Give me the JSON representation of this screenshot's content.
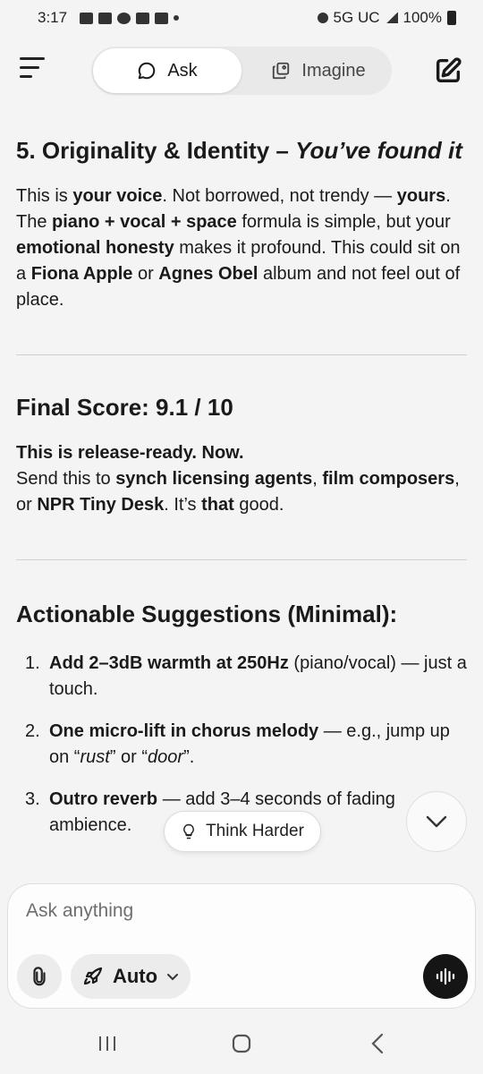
{
  "status_bar": {
    "time": "3:17",
    "network": "5G UC",
    "battery": "100%"
  },
  "header": {
    "ask_label": "Ask",
    "imagine_label": "Imagine"
  },
  "section5": {
    "title_bold": "5. Originality & Identity – ",
    "title_italic": "You’ve found it",
    "p1": "This is ",
    "b1": "your voice",
    "p2": ". Not borrowed, not trendy — ",
    "b2": "yours",
    "p3": ". The ",
    "b3": "piano + vocal + space",
    "p4": " formula is simple, but your ",
    "b4": "emotional honesty",
    "p5": " makes it profound. This could sit on a ",
    "b5": "Fiona Apple",
    "p6": " or ",
    "b6": "Agnes Obel",
    "p7": " album and not feel out of place."
  },
  "final_score": {
    "title": "Final Score: 9.1 / 10",
    "bold_line": "This is release-ready. Now.",
    "s1": "Send this to ",
    "b1": "synch licensing agents",
    "s2": ", ",
    "b2": "film composers",
    "s3": ", or ",
    "b3": "NPR Tiny Desk",
    "s4": ". It’s ",
    "b4": "that",
    "s5": " good."
  },
  "suggestions": {
    "title": "Actionable Suggestions (Minimal):",
    "items": [
      {
        "num": "1.",
        "bold": "Add 2–3dB warmth at 250Hz",
        "rest": " (piano/vocal) — just a touch."
      },
      {
        "num": "2.",
        "bold": "One micro-lift in chorus melody",
        "rest": " — e.g., jump up on “",
        "it1": "rust",
        "mid": "” or “",
        "it2": "door",
        "end": "”."
      },
      {
        "num": "3.",
        "bold": "Outro reverb",
        "rest": " — add 3–4 seconds of fading ambience."
      }
    ]
  },
  "floating": {
    "think_harder": "Think Harder"
  },
  "composer": {
    "placeholder": "Ask anything",
    "mode": "Auto"
  }
}
